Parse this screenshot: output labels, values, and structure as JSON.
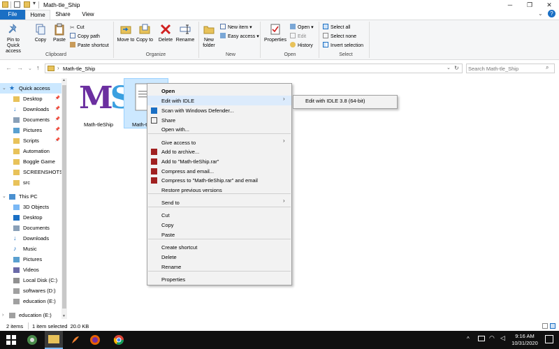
{
  "window": {
    "title": "Math-tle_Ship"
  },
  "tabs": [
    {
      "label": "File"
    },
    {
      "label": "Home"
    },
    {
      "label": "Share"
    },
    {
      "label": "View"
    }
  ],
  "ribbon": {
    "clipboard": {
      "label": "Clipboard",
      "pin": "Pin to Quick access",
      "copy": "Copy",
      "paste": "Paste",
      "cut": "Cut",
      "copy_path": "Copy path",
      "paste_shortcut": "Paste shortcut"
    },
    "organize": {
      "label": "Organize",
      "move_to": "Move to",
      "copy_to": "Copy to",
      "delete": "Delete",
      "rename": "Rename"
    },
    "new": {
      "label": "New",
      "new_folder": "New folder",
      "new_item": "New item ▾",
      "easy_access": "Easy access ▾"
    },
    "open": {
      "label": "Open",
      "properties": "Properties",
      "open": "Open ▾",
      "edit": "Edit",
      "history": "History"
    },
    "select": {
      "label": "Select",
      "select_all": "Select all",
      "select_none": "Select none",
      "invert": "Invert selection"
    }
  },
  "address": {
    "path": "Math-tle_Ship",
    "search_placeholder": "Search Math-tle_Ship"
  },
  "nav": {
    "quick_access": "Quick access",
    "quick_items": [
      {
        "label": "Desktop"
      },
      {
        "label": "Downloads"
      },
      {
        "label": "Documents"
      },
      {
        "label": "Pictures"
      },
      {
        "label": "Scripts"
      },
      {
        "label": "Automation"
      },
      {
        "label": "Boggle Game"
      },
      {
        "label": "SCREENSHOTS"
      },
      {
        "label": "src"
      }
    ],
    "this_pc": "This PC",
    "pc_items": [
      {
        "label": "3D Objects"
      },
      {
        "label": "Desktop"
      },
      {
        "label": "Documents"
      },
      {
        "label": "Downloads"
      },
      {
        "label": "Music"
      },
      {
        "label": "Pictures"
      },
      {
        "label": "Videos"
      },
      {
        "label": "Local Disk (C:)"
      },
      {
        "label": "softwares (D:)"
      },
      {
        "label": "education (E:)"
      }
    ],
    "bottom_item": "education (E:)"
  },
  "files": [
    {
      "name": "Math-tleShip",
      "logo": "MS"
    },
    {
      "name": "Math-t"
    }
  ],
  "context_menu": {
    "items": [
      "Open",
      "Edit with IDLE",
      "Scan with Windows Defender...",
      "Share",
      "Open with...",
      "Give access to",
      "Add to archive...",
      "Add to \"Math-tleShip.rar\"",
      "Compress and email...",
      "Compress to \"Math-tleShip.rar\" and email",
      "Restore previous versions",
      "Send to",
      "Cut",
      "Copy",
      "Paste",
      "Create shortcut",
      "Delete",
      "Rename",
      "Properties"
    ],
    "submenu_item": "Edit with IDLE 3.8 (64-bit)"
  },
  "status": {
    "items": "2 items",
    "selected": "1 item selected  20.0 KB"
  },
  "taskbar": {
    "time": "9:16 AM",
    "date": "10/31/2020"
  },
  "colors": {
    "accent": "#1a6fc4",
    "ms_purple": "#6b2fa0",
    "ms_blue": "#3aa0e0"
  }
}
